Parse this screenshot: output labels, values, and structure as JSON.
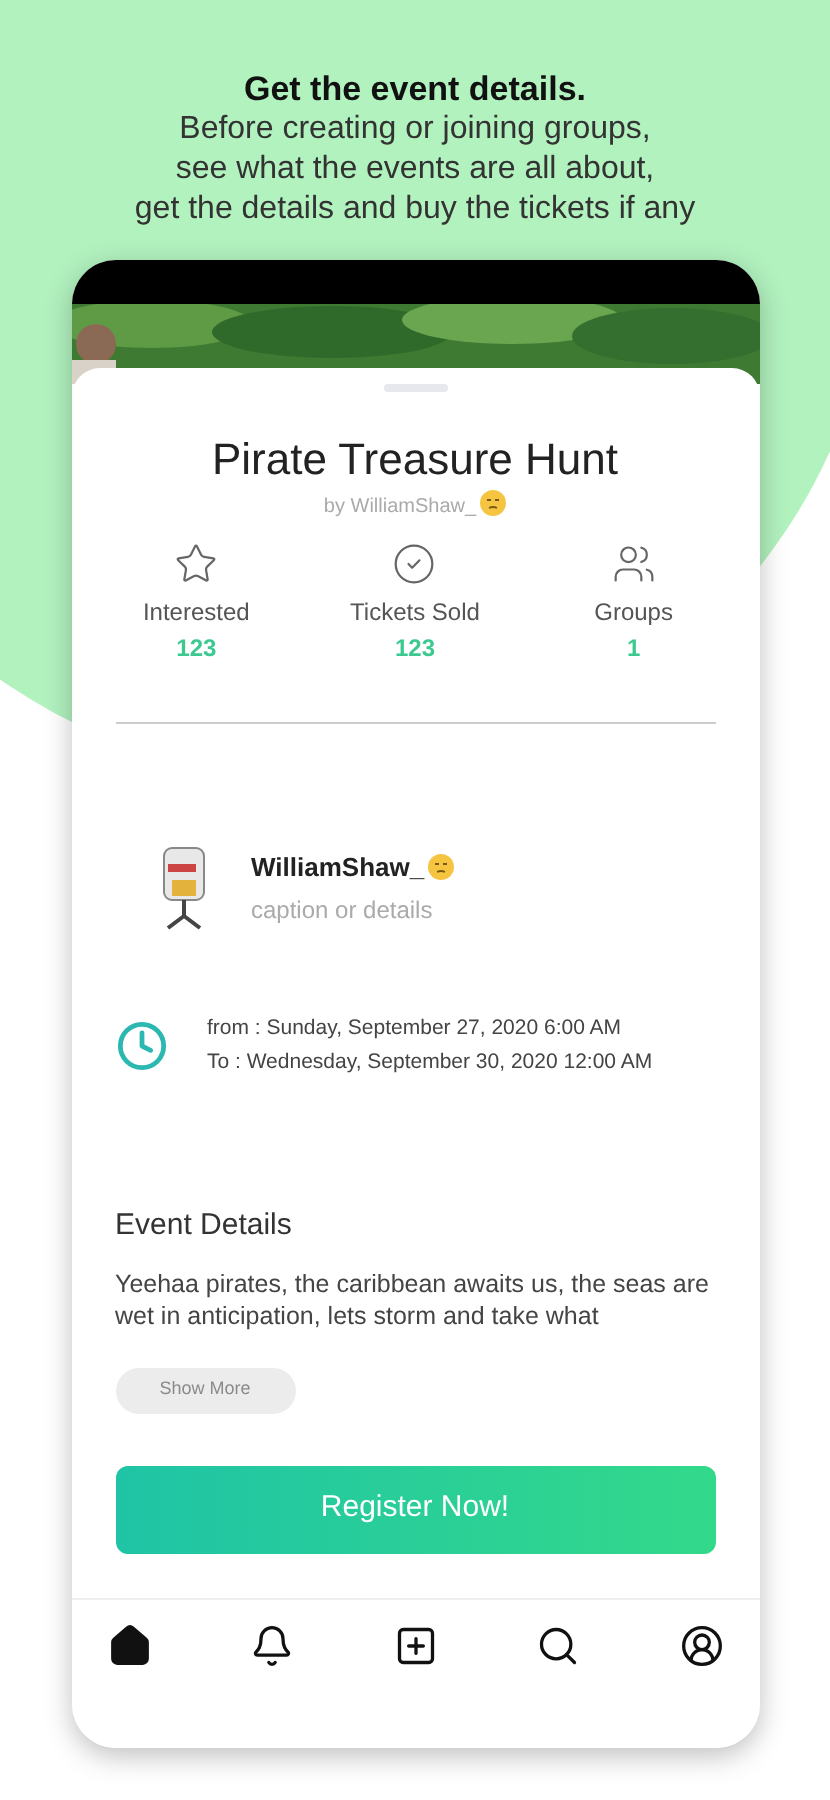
{
  "headline": "Get the event details.",
  "subtitle_lines": [
    "Before creating or joining groups,",
    "see what the events are all about,",
    "get the details and buy the tickets if  any"
  ],
  "event": {
    "title": "Pirate Treasure Hunt",
    "byline": "by WilliamShaw_"
  },
  "stats": [
    {
      "kind": "star",
      "label": "Interested",
      "value": "123"
    },
    {
      "kind": "check",
      "label": "Tickets Sold",
      "value": "123"
    },
    {
      "kind": "users",
      "label": "Groups",
      "value": "1"
    }
  ],
  "organizer": {
    "name": "WilliamShaw_",
    "caption": "caption or details"
  },
  "schedule": {
    "from": "from : Sunday, September 27, 2020 6:00 AM",
    "to": "To : Wednesday, September 30, 2020 12:00 AM"
  },
  "details": {
    "heading": "Event Details",
    "text": "Yeehaa pirates, the caribbean awaits us, the seas are wet in anticipation, lets storm and take what",
    "show_more": "Show More"
  },
  "register_button": "Register Now!",
  "nav": [
    {
      "kind": "home",
      "selected": true
    },
    {
      "kind": "bell",
      "selected": false
    },
    {
      "kind": "plus",
      "selected": false
    },
    {
      "kind": "search",
      "selected": false
    },
    {
      "kind": "profile",
      "selected": false
    }
  ]
}
